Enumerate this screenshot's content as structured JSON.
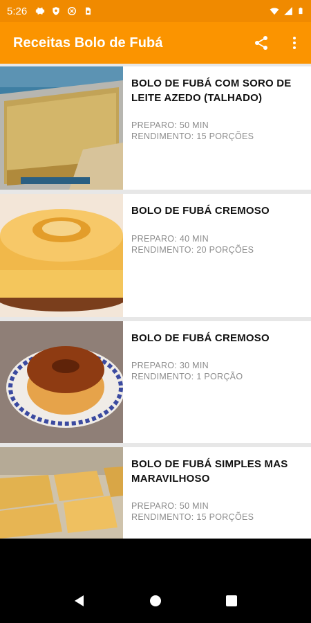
{
  "status": {
    "time": "5:26",
    "left_icons": [
      "gear-icon",
      "shield-icon",
      "at-sign-icon",
      "sim-card-icon"
    ],
    "right_icons": [
      "wifi-icon",
      "signal-icon",
      "battery-icon"
    ]
  },
  "app_bar": {
    "title": "Receitas Bolo de Fubá",
    "actions": [
      "share-icon",
      "more-vert-icon"
    ]
  },
  "recipes": [
    {
      "title": "BOLO DE FUBÁ COM SORO DE LEITE AZEDO (TALHADO)",
      "preparo": "PREPARO: 50 MIN",
      "rendimento": "RENDIMENTO: 15 PORÇÕES",
      "image": "sheet-cake-photo"
    },
    {
      "title": "BOLO DE FUBÁ CREMOSO",
      "preparo": "PREPARO: 40 MIN",
      "rendimento": "RENDIMENTO: 20 PORÇÕES",
      "image": "bundt-cake-photo"
    },
    {
      "title": "BOLO DE FUBÁ CREMOSO",
      "preparo": "PREPARO: 30 MIN",
      "rendimento": "RENDIMENTO: 1 PORÇÃO",
      "image": "ring-cake-on-plate-photo"
    },
    {
      "title": "BOLO DE FUBÁ SIMPLES MAS MARAVILHOSO",
      "preparo": "PREPARO: 50 MIN",
      "rendimento": "RENDIMENTO: 15 PORÇÕES",
      "image": "cake-squares-photo"
    }
  ],
  "nav": [
    "back-icon",
    "home-icon",
    "recents-icon"
  ],
  "colors": {
    "app_bar": "#fb9400",
    "status_bar": "#f08a00",
    "list_background": "#e7e7e7"
  }
}
